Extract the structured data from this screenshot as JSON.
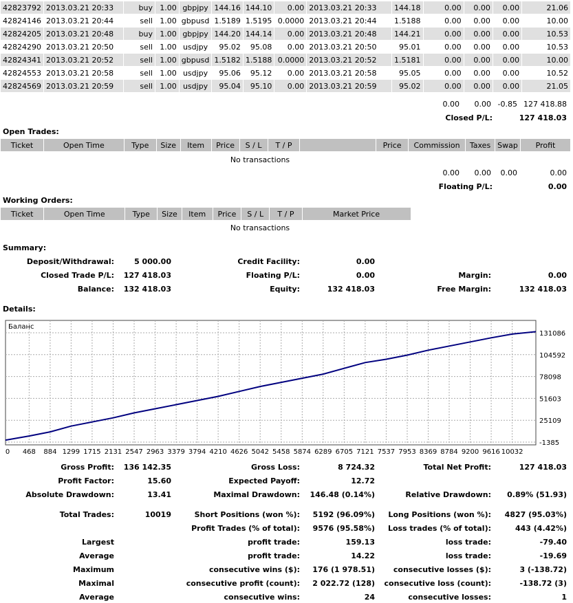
{
  "closed_trades": [
    [
      "42823792",
      "2013.03.21 20:33",
      "buy",
      "1.00",
      "gbpjpy",
      "144.16",
      "144.10",
      "0.00",
      "2013.03.21 20:33",
      "144.18",
      "0.00",
      "0.00",
      "0.00",
      "21.06"
    ],
    [
      "42824146",
      "2013.03.21 20:44",
      "sell",
      "1.00",
      "gbpusd",
      "1.5189",
      "1.5195",
      "0.0000",
      "2013.03.21 20:44",
      "1.5188",
      "0.00",
      "0.00",
      "0.00",
      "10.00"
    ],
    [
      "42824205",
      "2013.03.21 20:48",
      "buy",
      "1.00",
      "gbpjpy",
      "144.20",
      "144.14",
      "0.00",
      "2013.03.21 20:48",
      "144.21",
      "0.00",
      "0.00",
      "0.00",
      "10.53"
    ],
    [
      "42824290",
      "2013.03.21 20:50",
      "sell",
      "1.00",
      "usdjpy",
      "95.02",
      "95.08",
      "0.00",
      "2013.03.21 20:50",
      "95.01",
      "0.00",
      "0.00",
      "0.00",
      "10.53"
    ],
    [
      "42824341",
      "2013.03.21 20:52",
      "sell",
      "1.00",
      "gbpusd",
      "1.5182",
      "1.5188",
      "0.0000",
      "2013.03.21 20:52",
      "1.5181",
      "0.00",
      "0.00",
      "0.00",
      "10.00"
    ],
    [
      "42824553",
      "2013.03.21 20:58",
      "sell",
      "1.00",
      "usdjpy",
      "95.06",
      "95.12",
      "0.00",
      "2013.03.21 20:58",
      "95.05",
      "0.00",
      "0.00",
      "0.00",
      "10.52"
    ],
    [
      "42824569",
      "2013.03.21 20:59",
      "sell",
      "1.00",
      "usdjpy",
      "95.04",
      "95.10",
      "0.00",
      "2013.03.21 20:59",
      "95.02",
      "0.00",
      "0.00",
      "0.00",
      "21.05"
    ]
  ],
  "closed_totals": {
    "commission": "0.00",
    "taxes": "0.00",
    "swap": "-0.85",
    "profit": "127 418.88",
    "label": "Closed P/L:",
    "value": "127 418.03"
  },
  "open_trades": {
    "title": "Open Trades:",
    "headers": [
      "Ticket",
      "Open Time",
      "Type",
      "Size",
      "Item",
      "Price",
      "S / L",
      "T / P",
      "",
      "Price",
      "Commission",
      "Taxes",
      "Swap",
      "Profit"
    ],
    "empty": "No transactions",
    "totals": {
      "commission": "0.00",
      "taxes": "0.00",
      "swap": "0.00",
      "profit": "0.00"
    },
    "floating_label": "Floating P/L:",
    "floating_value": "0.00"
  },
  "working_orders": {
    "title": "Working Orders:",
    "headers": [
      "Ticket",
      "Open Time",
      "Type",
      "Size",
      "Item",
      "Price",
      "S / L",
      "T / P",
      "Market Price",
      ""
    ],
    "empty": "No transactions"
  },
  "summary": {
    "title": "Summary:",
    "deposit_label": "Deposit/Withdrawal:",
    "deposit": "5 000.00",
    "credit_label": "Credit Facility:",
    "credit": "0.00",
    "closed_label": "Closed Trade P/L:",
    "closed": "127 418.03",
    "floating_label": "Floating P/L:",
    "floating": "0.00",
    "margin_label": "Margin:",
    "margin": "0.00",
    "balance_label": "Balance:",
    "balance": "132 418.03",
    "equity_label": "Equity:",
    "equity": "132 418.03",
    "free_margin_label": "Free Margin:",
    "free_margin": "132 418.03"
  },
  "details_title": "Details:",
  "chart_data": {
    "type": "line",
    "title": "Баланс",
    "x": [
      0,
      468,
      884,
      1299,
      1715,
      2131,
      2547,
      2963,
      3379,
      3794,
      4210,
      4626,
      5042,
      5458,
      5874,
      6289,
      6705,
      7121,
      7537,
      7953,
      8369,
      8784,
      9200,
      9616,
      10032,
      10500
    ],
    "series": [
      {
        "values": [
          1000,
          6000,
          11000,
          18000,
          23000,
          28000,
          34000,
          39000,
          44000,
          49000,
          54000,
          60000,
          66000,
          71000,
          76000,
          81000,
          88000,
          95000,
          99000,
          104000,
          110000,
          115000,
          120000,
          125000,
          129500,
          132418
        ]
      }
    ],
    "xticks": [
      "0",
      "468",
      "884",
      "1299",
      "1715",
      "2131",
      "2547",
      "2963",
      "3379",
      "3794",
      "4210",
      "4626",
      "5042",
      "5458",
      "5874",
      "6289",
      "6705",
      "7121",
      "7537",
      "7953",
      "8369",
      "8784",
      "9200",
      "9616",
      "10032"
    ],
    "yticks": [
      "131086",
      "104592",
      "78098",
      "51603",
      "25109",
      "-1385"
    ],
    "ylim": [
      -1385,
      131086
    ],
    "xlim": [
      0,
      10500
    ],
    "grid": true,
    "color": "#00007f"
  },
  "stats": {
    "gross_profit_label": "Gross Profit:",
    "gross_profit": "136 142.35",
    "gross_loss_label": "Gross Loss:",
    "gross_loss": "8 724.32",
    "net_profit_label": "Total Net Profit:",
    "net_profit": "127 418.03",
    "profit_factor_label": "Profit Factor:",
    "profit_factor": "15.60",
    "expected_payoff_label": "Expected Payoff:",
    "expected_payoff": "12.72",
    "abs_dd_label": "Absolute Drawdown:",
    "abs_dd": "13.41",
    "max_dd_label": "Maximal Drawdown:",
    "max_dd": "146.48 (0.14%)",
    "rel_dd_label": "Relative Drawdown:",
    "rel_dd": "0.89% (51.93)",
    "total_trades_label": "Total Trades:",
    "total_trades": "10019",
    "short_label": "Short Positions (won %):",
    "short": "5192 (96.09%)",
    "long_label": "Long Positions (won %):",
    "long": "4827 (95.03%)",
    "profit_trades_label": "Profit Trades (% of total):",
    "profit_trades": "9576 (95.58%)",
    "loss_trades_label": "Loss trades (% of total):",
    "loss_trades": "443 (4.42%)",
    "largest_label": "Largest",
    "largest_profit_label": "profit trade:",
    "largest_profit": "159.13",
    "largest_loss_label": "loss trade:",
    "largest_loss": "-79.40",
    "average_label": "Average",
    "average_profit_label": "profit trade:",
    "average_profit": "14.22",
    "average_loss_label": "loss trade:",
    "average_loss": "-19.69",
    "maximum_label": "Maximum",
    "max_wins_label": "consecutive wins ($):",
    "max_wins": "176 (1 978.51)",
    "max_losses_label": "consecutive losses ($):",
    "max_losses": "3 (-138.72)",
    "maximal_label": "Maximal",
    "maximal_profit_label": "consecutive profit (count):",
    "maximal_profit": "2 022.72 (128)",
    "maximal_loss_label": "consecutive loss (count):",
    "maximal_loss": "-138.72 (3)",
    "average2_label": "Average",
    "avg_wins_label": "consecutive wins:",
    "avg_wins": "24",
    "avg_losses_label": "consecutive losses:",
    "avg_losses": "1"
  }
}
